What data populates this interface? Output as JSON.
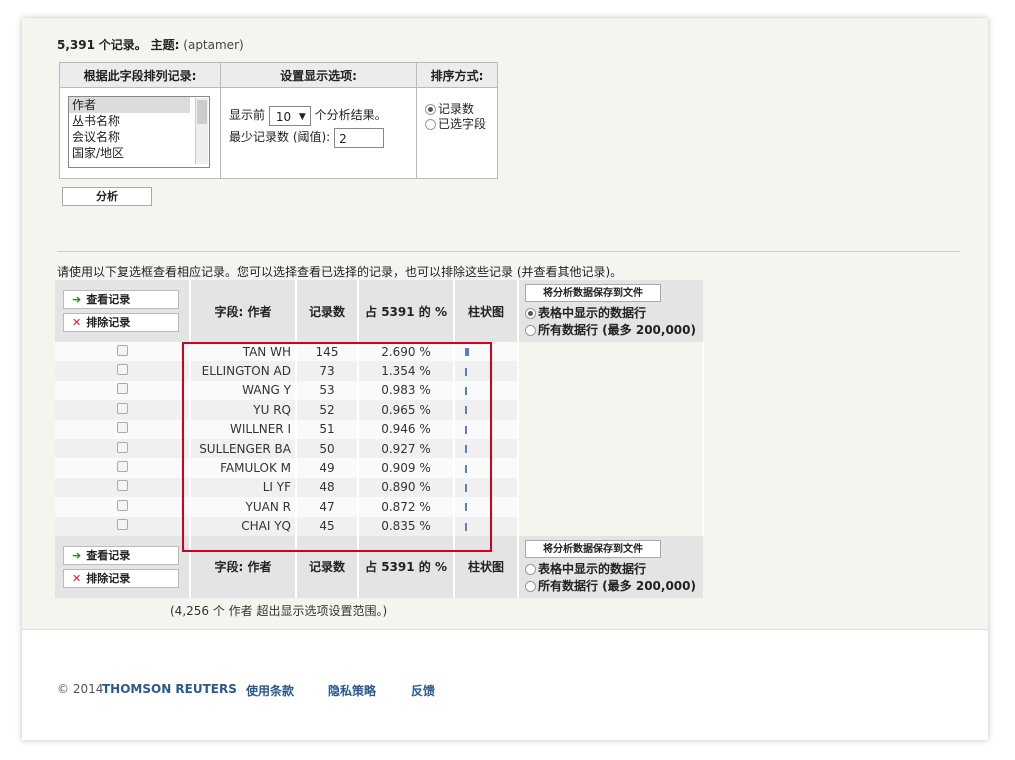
{
  "summary": {
    "count": "5,391",
    "unit": "个记录。",
    "topic_label": "主题:",
    "topic": "(aptamer)"
  },
  "options": {
    "col1_header": "根据此字段排列记录:",
    "col2_header": "设置显示选项:",
    "col3_header": "排序方式:",
    "fields": [
      "作者",
      "丛书名称",
      "会议名称",
      "国家/地区"
    ],
    "show_prefix": "显示前",
    "show_value": "10",
    "show_suffix": "个分析结果。",
    "min_label": "最少记录数 (阈值):",
    "min_value": "2",
    "sort_by_count": "记录数",
    "sort_by_field": "已选字段"
  },
  "analyze_label": "分析",
  "instruction": "请使用以下复选框查看相应记录。您可以选择查看已选择的记录，也可以排除这些记录 (并查看其他记录)。",
  "actions": {
    "view": "查看记录",
    "exclude": "排除记录"
  },
  "columns": {
    "field": "字段: 作者",
    "count": "记录数",
    "pct": "占 5391 的 %",
    "bar": "柱状图"
  },
  "save": {
    "button": "将分析数据保存到文件",
    "opt_table": "表格中显示的数据行",
    "opt_all": "所有数据行 (最多 200,000)"
  },
  "rows": [
    {
      "name": "TAN WH",
      "count": "145",
      "pct": "2.690 %",
      "bar": 2.69
    },
    {
      "name": "ELLINGTON AD",
      "count": "73",
      "pct": "1.354 %",
      "bar": 1.354
    },
    {
      "name": "WANG Y",
      "count": "53",
      "pct": "0.983 %",
      "bar": 0.983
    },
    {
      "name": "YU RQ",
      "count": "52",
      "pct": "0.965 %",
      "bar": 0.965
    },
    {
      "name": "WILLNER I",
      "count": "51",
      "pct": "0.946 %",
      "bar": 0.946
    },
    {
      "name": "SULLENGER BA",
      "count": "50",
      "pct": "0.927 %",
      "bar": 0.927
    },
    {
      "name": "FAMULOK M",
      "count": "49",
      "pct": "0.909 %",
      "bar": 0.909
    },
    {
      "name": "LI YF",
      "count": "48",
      "pct": "0.890 %",
      "bar": 0.89
    },
    {
      "name": "YUAN R",
      "count": "47",
      "pct": "0.872 %",
      "bar": 0.872
    },
    {
      "name": "CHAI YQ",
      "count": "45",
      "pct": "0.835 %",
      "bar": 0.835
    }
  ],
  "beyond_note": "(4,256 个 作者 超出显示选项设置范围。)",
  "footer": {
    "copyright": "© 2014",
    "brand": "THOMSON REUTERS",
    "terms": "使用条款",
    "privacy": "隐私策略",
    "feedback": "反馈"
  },
  "colors": {
    "bar": "#5b7fb8",
    "highlight_box": "#d0021b",
    "link": "#2a5a8c"
  }
}
